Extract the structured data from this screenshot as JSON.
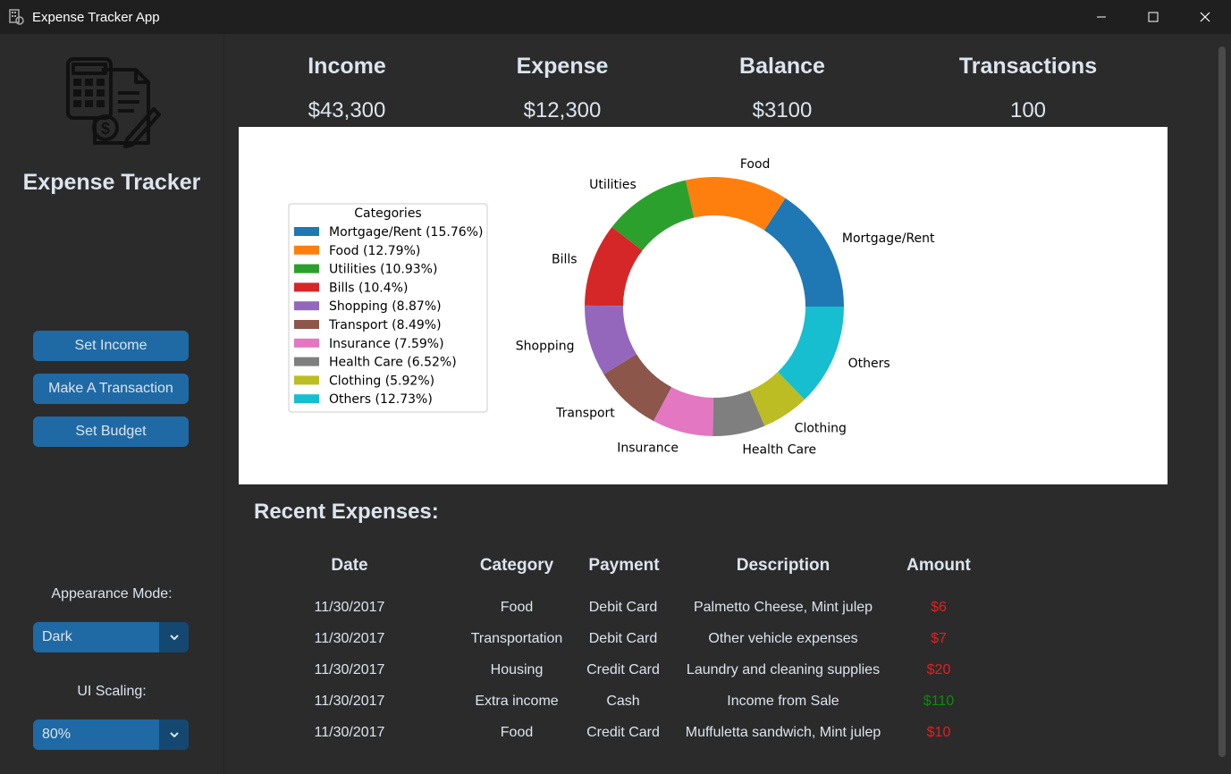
{
  "window": {
    "title": "Expense Tracker App",
    "icon": "app-icon",
    "controls": [
      "minimize-icon",
      "maximize-icon",
      "close-icon"
    ]
  },
  "sidebar": {
    "logo_icon": "calculator-invoice-icon",
    "app_name": "Expense Tracker",
    "buttons": {
      "set_income": "Set Income",
      "make_transaction": "Make A Transaction",
      "set_budget": "Set Budget"
    },
    "appearance_label": "Appearance Mode:",
    "appearance_value": "Dark",
    "scaling_label": "UI Scaling:",
    "scaling_value": "80%"
  },
  "stats": {
    "income": {
      "label": "Income",
      "value": "$43,300"
    },
    "expense": {
      "label": "Expense",
      "value": "$12,300"
    },
    "balance": {
      "label": "Balance",
      "value": "$3100"
    },
    "transactions": {
      "label": "Transactions",
      "value": "100"
    }
  },
  "chart_data": {
    "type": "pie",
    "donut": true,
    "legend_title": "Categories",
    "legend_position": "left",
    "categories": [
      "Mortgage/Rent",
      "Food",
      "Utilities",
      "Bills",
      "Shopping",
      "Transport",
      "Insurance",
      "Health Care",
      "Clothing",
      "Others"
    ],
    "values": [
      15.76,
      12.79,
      10.93,
      10.4,
      8.87,
      8.49,
      7.59,
      6.52,
      5.92,
      12.73
    ],
    "legend_labels": [
      "Mortgage/Rent (15.76%)",
      "Food (12.79%)",
      "Utilities (10.93%)",
      "Bills (10.4%)",
      "Shopping (8.87%)",
      "Transport (8.49%)",
      "Insurance (7.59%)",
      "Health Care (6.52%)",
      "Clothing (5.92%)",
      "Others (12.73%)"
    ],
    "colors": [
      "#1f77b4",
      "#ff7f0e",
      "#2ca02c",
      "#d62728",
      "#9467bd",
      "#8c564b",
      "#e377c2",
      "#7f7f7f",
      "#bcbd22",
      "#17becf"
    ]
  },
  "recent": {
    "title": "Recent Expenses:",
    "columns": [
      "Date",
      "Category",
      "Payment",
      "Description",
      "Amount"
    ],
    "rows": [
      {
        "date": "11/30/2017",
        "category": "Food",
        "payment": "Debit Card",
        "description": "Palmetto Cheese, Mint julep",
        "amount": "$6",
        "type": "expense"
      },
      {
        "date": "11/30/2017",
        "category": "Transportation",
        "payment": "Debit Card",
        "description": "Other vehicle expenses",
        "amount": "$7",
        "type": "expense"
      },
      {
        "date": "11/30/2017",
        "category": "Housing",
        "payment": "Credit Card",
        "description": "Laundry and cleaning supplies",
        "amount": "$20",
        "type": "expense"
      },
      {
        "date": "11/30/2017",
        "category": "Extra income",
        "payment": "Cash",
        "description": "Income from Sale",
        "amount": "$110",
        "type": "income"
      },
      {
        "date": "11/30/2017",
        "category": "Food",
        "payment": "Credit Card",
        "description": "Muffuletta sandwich, Mint julep",
        "amount": "$10",
        "type": "expense"
      }
    ],
    "colors": {
      "expense": "#e02020",
      "income": "#0e8a0e"
    }
  }
}
